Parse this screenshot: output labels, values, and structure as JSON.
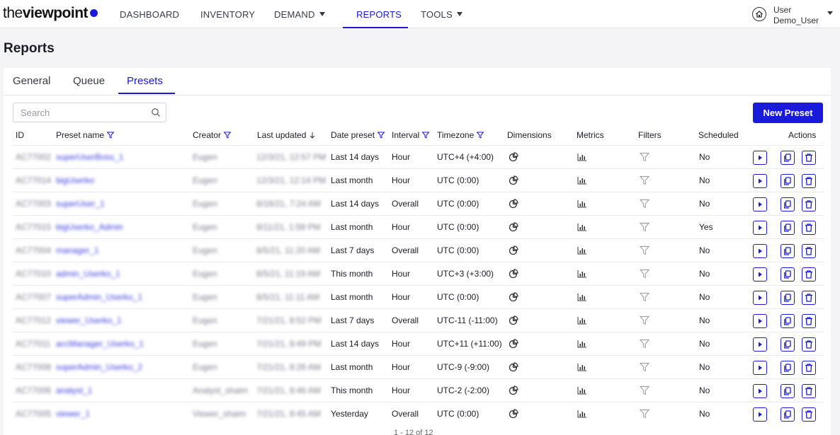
{
  "app": {
    "logo_light": "the",
    "logo_bold": "viewpoint",
    "nav": [
      {
        "label": "DASHBOARD",
        "dropdown": false,
        "active": false
      },
      {
        "label": "INVENTORY",
        "dropdown": false,
        "active": false
      },
      {
        "label": "DEMAND",
        "dropdown": true,
        "active": false
      },
      {
        "label": "REPORTS",
        "dropdown": false,
        "active": true
      },
      {
        "label": "TOOLS",
        "dropdown": true,
        "active": false
      }
    ],
    "user": {
      "role": "User",
      "name": "Demo_User",
      "icon": "home-icon"
    }
  },
  "page": {
    "title": "Reports"
  },
  "tabs": [
    {
      "label": "General",
      "active": false
    },
    {
      "label": "Queue",
      "active": false
    },
    {
      "label": "Presets",
      "active": true
    }
  ],
  "search": {
    "placeholder": "Search",
    "value": ""
  },
  "toolbar": {
    "new_preset_label": "New Preset"
  },
  "table": {
    "columns": [
      {
        "label": "ID",
        "filter": false,
        "sort": false
      },
      {
        "label": "Preset name",
        "filter": true,
        "sort": false
      },
      {
        "label": "Creator",
        "filter": true,
        "sort": false
      },
      {
        "label": "Last updated",
        "filter": false,
        "sort": "desc"
      },
      {
        "label": "Date preset",
        "filter": true,
        "sort": false
      },
      {
        "label": "Interval",
        "filter": true,
        "sort": false
      },
      {
        "label": "Timezone",
        "filter": true,
        "sort": false
      },
      {
        "label": "Dimensions",
        "filter": false,
        "sort": false
      },
      {
        "label": "Metrics",
        "filter": false,
        "sort": false
      },
      {
        "label": "Filters",
        "filter": false,
        "sort": false
      },
      {
        "label": "Scheduled",
        "filter": false,
        "sort": false
      },
      {
        "label": "Actions",
        "filter": false,
        "sort": false
      }
    ],
    "rows": [
      {
        "id": "AC77002",
        "name": "superUserBoss_1",
        "creator": "Eugen",
        "updated": "12/3/21, 12:57 PM",
        "date_preset": "Last 14 days",
        "interval": "Hour",
        "timezone": "UTC+4 (+4:00)",
        "scheduled": "No"
      },
      {
        "id": "AC77014",
        "name": "bigUserko",
        "creator": "Eugen",
        "updated": "12/3/21, 12:14 PM",
        "date_preset": "Last month",
        "interval": "Hour",
        "timezone": "UTC (0:00)",
        "scheduled": "No"
      },
      {
        "id": "AC77003",
        "name": "superUser_1",
        "creator": "Eugen",
        "updated": "8/18/21, 7:24 AM",
        "date_preset": "Last 14 days",
        "interval": "Overall",
        "timezone": "UTC (0:00)",
        "scheduled": "No"
      },
      {
        "id": "AC77015",
        "name": "bigUserko_Admin",
        "creator": "Eugen",
        "updated": "8/11/21, 1:58 PM",
        "date_preset": "Last month",
        "interval": "Hour",
        "timezone": "UTC (0:00)",
        "scheduled": "Yes"
      },
      {
        "id": "AC77004",
        "name": "manager_1",
        "creator": "Eugen",
        "updated": "8/5/21, 11:20 AM",
        "date_preset": "Last 7 days",
        "interval": "Overall",
        "timezone": "UTC (0:00)",
        "scheduled": "No"
      },
      {
        "id": "AC77010",
        "name": "admin_Userko_1",
        "creator": "Eugen",
        "updated": "8/5/21, 11:19 AM",
        "date_preset": "This month",
        "interval": "Hour",
        "timezone": "UTC+3 (+3:00)",
        "scheduled": "No"
      },
      {
        "id": "AC77007",
        "name": "superAdmin_Userko_1",
        "creator": "Eugen",
        "updated": "8/5/21, 11:11 AM",
        "date_preset": "Last month",
        "interval": "Hour",
        "timezone": "UTC (0:00)",
        "scheduled": "No"
      },
      {
        "id": "AC77012",
        "name": "viewer_Userko_1",
        "creator": "Eugen",
        "updated": "7/21/21, 8:52 PM",
        "date_preset": "Last 7 days",
        "interval": "Overall",
        "timezone": "UTC-11 (-11:00)",
        "scheduled": "No"
      },
      {
        "id": "AC77011",
        "name": "accManager_Userko_1",
        "creator": "Eugen",
        "updated": "7/21/21, 8:49 PM",
        "date_preset": "Last 14 days",
        "interval": "Hour",
        "timezone": "UTC+11 (+11:00)",
        "scheduled": "No"
      },
      {
        "id": "AC77008",
        "name": "superAdmin_Userko_2",
        "creator": "Eugen",
        "updated": "7/21/21, 8:26 AM",
        "date_preset": "Last month",
        "interval": "Hour",
        "timezone": "UTC-9 (-9:00)",
        "scheduled": "No"
      },
      {
        "id": "AC77006",
        "name": "analyst_1",
        "creator": "Analyst_shaim",
        "updated": "7/21/21, 8:46 AM",
        "date_preset": "This month",
        "interval": "Hour",
        "timezone": "UTC-2 (-2:00)",
        "scheduled": "No"
      },
      {
        "id": "AC77005",
        "name": "viewer_1",
        "creator": "Viewer_shaim",
        "updated": "7/21/21, 8:45 AM",
        "date_preset": "Yesterday",
        "interval": "Overall",
        "timezone": "UTC (0:00)",
        "scheduled": "No"
      }
    ]
  },
  "pagination": {
    "label": "1 - 12 of 12"
  },
  "colors": {
    "accent": "#1a1adb",
    "text": "#1c1c28",
    "muted": "#9a9aa6"
  }
}
